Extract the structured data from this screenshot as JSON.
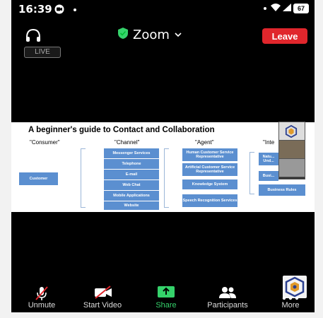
{
  "status": {
    "time": "16:39",
    "battery": "67"
  },
  "header": {
    "title": "Zoom",
    "leave_label": "Leave",
    "live_label": "LIVE"
  },
  "slide": {
    "title": "A beginner's guide to Contact and Collaboration",
    "columns": [
      "\"Consumer\"",
      "\"Channel\"",
      "\"Agent\"",
      "\"Inte"
    ],
    "consumer": "Customer",
    "channels": [
      "Messenger Services",
      "Telephone",
      "E-mail",
      "Web Chat",
      "Mobile Applications",
      "Website"
    ],
    "agents": [
      "Human Customer Service Representative",
      "Artificial Customer Service Representative",
      "Knowledge System",
      "Speech Recognition Services"
    ],
    "integration": [
      "Natu... Und...",
      "Busi...",
      "Business Rules"
    ]
  },
  "toolbar": {
    "unmute": "Unmute",
    "start_video": "Start Video",
    "share": "Share",
    "participants": "Participants",
    "more": "More"
  },
  "colors": {
    "leave": "#e0262c",
    "share": "#35d26b",
    "slide_box": "#5b8fd0"
  }
}
